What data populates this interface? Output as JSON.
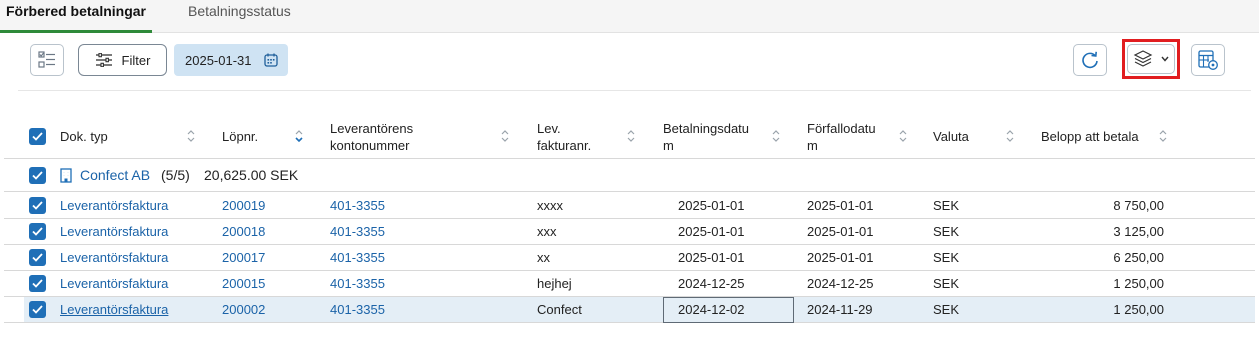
{
  "tabs": {
    "active": "Förbered betalningar",
    "inactive": "Betalningsstatus"
  },
  "toolbar": {
    "filter_label": "Filter",
    "date": "2025-01-31"
  },
  "columns": {
    "doc_type": "Dok. typ",
    "lopnr": "Löpnr.",
    "account_line1": "Leverantörens",
    "account_line2": "kontonummer",
    "invoice_line1": "Lev.",
    "invoice_line2": "fakturanr.",
    "paydate_line1": "Betalningsdatu",
    "paydate_line2": "m",
    "duedate_line1": "Förfallodatu",
    "duedate_line2": "m",
    "currency": "Valuta",
    "amount": "Belopp att betala"
  },
  "group": {
    "name": "Confect AB",
    "count": "(5/5)",
    "total": "20,625.00 SEK"
  },
  "rows": [
    {
      "doc_type": "Leverantörsfaktura",
      "lopnr": "200019",
      "account": "401-3355",
      "invoice": "xxxx",
      "paydate": "2025-01-01",
      "duedate": "2025-01-01",
      "currency": "SEK",
      "amount": "8 750,00"
    },
    {
      "doc_type": "Leverantörsfaktura",
      "lopnr": "200018",
      "account": "401-3355",
      "invoice": "xxx",
      "paydate": "2025-01-01",
      "duedate": "2025-01-01",
      "currency": "SEK",
      "amount": "3 125,00"
    },
    {
      "doc_type": "Leverantörsfaktura",
      "lopnr": "200017",
      "account": "401-3355",
      "invoice": "xx",
      "paydate": "2025-01-01",
      "duedate": "2025-01-01",
      "currency": "SEK",
      "amount": "6 250,00"
    },
    {
      "doc_type": "Leverantörsfaktura",
      "lopnr": "200015",
      "account": "401-3355",
      "invoice": "hejhej",
      "paydate": "2024-12-25",
      "duedate": "2024-12-25",
      "currency": "SEK",
      "amount": "1 250,00"
    },
    {
      "doc_type": "Leverantörsfaktura",
      "lopnr": "200002",
      "account": "401-3355",
      "invoice": "Confect",
      "paydate": "2024-12-02",
      "duedate": "2024-11-29",
      "currency": "SEK",
      "amount": "1 250,00"
    }
  ],
  "colors": {
    "accent": "#1f6fb7",
    "link": "#1b63a8",
    "tab_underline": "#2f8a3a",
    "highlight_border": "#e11d20",
    "date_chip": "#cfe3f3",
    "selected_row": "#e4eef6"
  },
  "icons": [
    "checklist-icon",
    "filter-sliders-icon",
    "calendar-icon",
    "refresh-icon",
    "layers-icon",
    "chevron-down-icon",
    "table-settings-icon",
    "sort-icon",
    "building-icon",
    "checkbox-icon"
  ]
}
